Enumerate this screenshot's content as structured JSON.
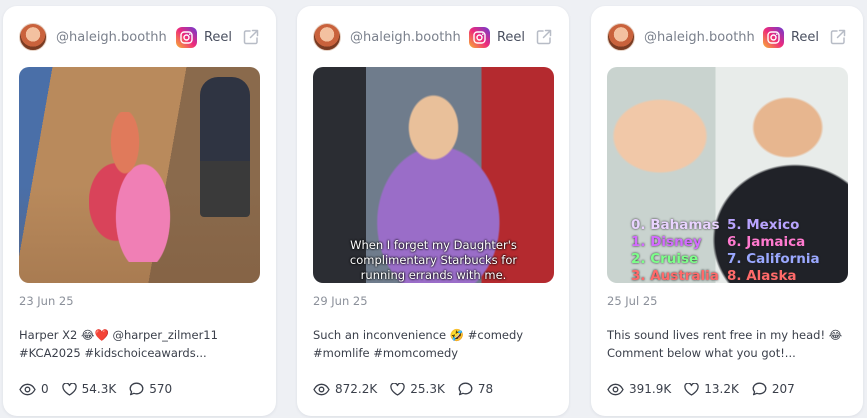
{
  "colors": {
    "page_bg": "#eef0f4",
    "card_bg": "#ffffff",
    "muted_text": "#8b909a",
    "body_text": "#3a3f4a"
  },
  "cards": [
    {
      "handle": "@haleigh.boothh",
      "platform_label": "Reel",
      "date": "23 Jun 25",
      "caption_lines": [
        "Harper X2 😂❤️ @harper_zilmer11",
        "#KCA2025 #kidschoiceawards..."
      ],
      "stats": {
        "views": "0",
        "likes": "54.3K",
        "comments": "570"
      },
      "media_overlay": ""
    },
    {
      "handle": "@haleigh.boothh",
      "platform_label": "Reel",
      "date": "29 Jun 25",
      "caption_lines": [
        "Such an inconvenience 🤣 #comedy",
        "#momlife #momcomedy"
      ],
      "stats": {
        "views": "872.2K",
        "likes": "25.3K",
        "comments": "78"
      },
      "media_overlay": "When I forget my Daughter's complimentary Starbucks for running errands with me."
    },
    {
      "handle": "@haleigh.boothh",
      "platform_label": "Reel",
      "date": "25 Jul 25",
      "caption_lines": [
        "This sound lives rent free in my head! 😂",
        "Comment below what you got!..."
      ],
      "stats": {
        "views": "391.9K",
        "likes": "13.2K",
        "comments": "207"
      },
      "media_overlay_list": [
        {
          "text": "0. Bahamas",
          "color": "#e9d4ff"
        },
        {
          "text": "5. Mexico",
          "color": "#b9a4ff"
        },
        {
          "text": "1. Disney",
          "color": "#d36bff"
        },
        {
          "text": "6. Jamaica",
          "color": "#ff7ad0"
        },
        {
          "text": "2. Cruise",
          "color": "#7dff8a"
        },
        {
          "text": "7. California",
          "color": "#9aa8ff"
        },
        {
          "text": "3. Australia",
          "color": "#ff6a6a"
        },
        {
          "text": "8. Alaska",
          "color": "#ff6a6a"
        }
      ]
    }
  ]
}
